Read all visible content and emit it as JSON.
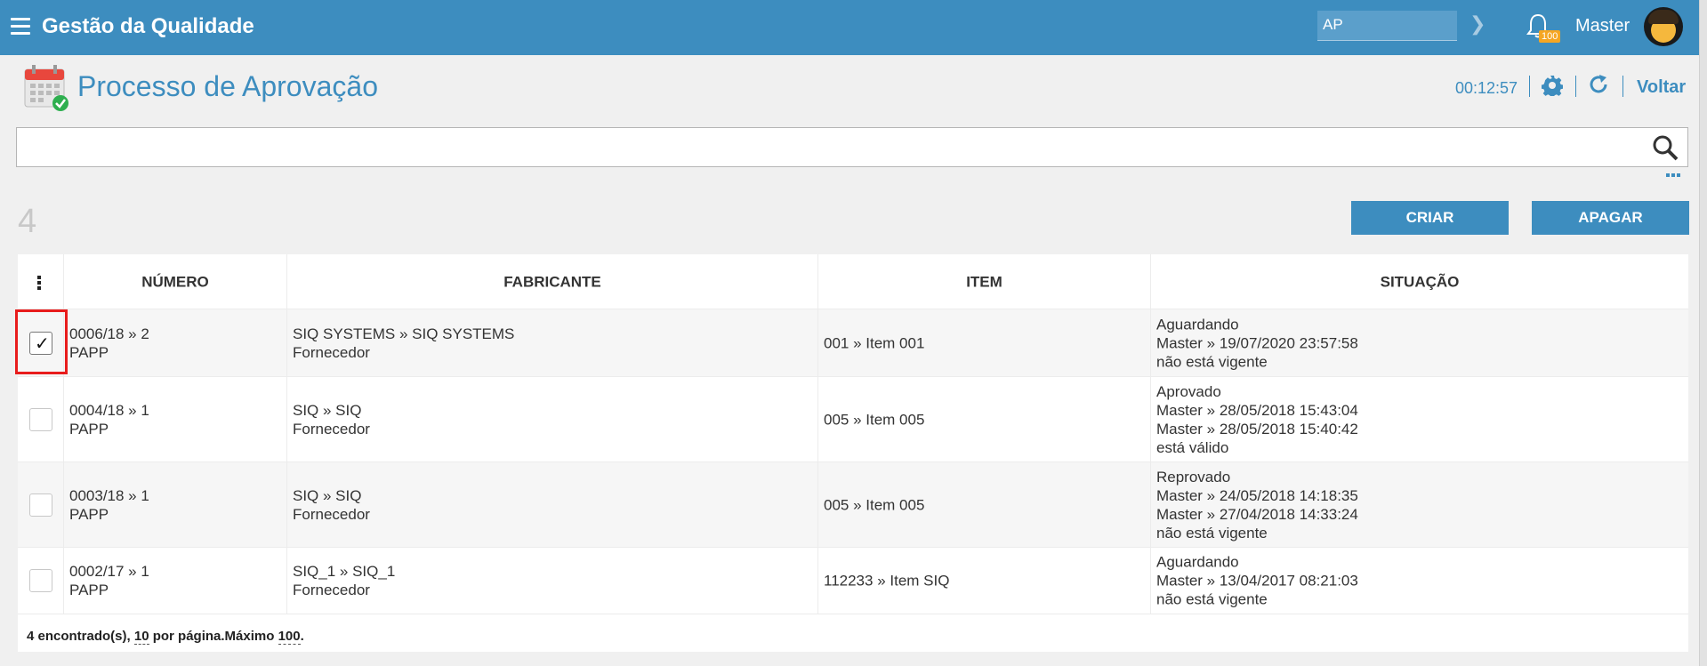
{
  "topbar": {
    "app_title": "Gestão da Qualidade",
    "search_value": "AP",
    "notification_count": "100",
    "username": "Master"
  },
  "header": {
    "page_title": "Processo de Aprovação",
    "timer": "00:12:57",
    "back_label": "Voltar"
  },
  "search": {
    "value": ""
  },
  "toolbar": {
    "record_count": "4",
    "create_label": "CRIAR",
    "delete_label": "APAGAR"
  },
  "table": {
    "headers": [
      "NÚMERO",
      "FABRICANTE",
      "ITEM",
      "SITUAÇÃO"
    ],
    "rows": [
      {
        "checked": true,
        "numero": [
          "0006/18 » 2",
          "PAPP"
        ],
        "fabricante": [
          "SIQ SYSTEMS » SIQ SYSTEMS",
          "Fornecedor"
        ],
        "item": [
          "001 » Item 001"
        ],
        "situacao": [
          "Aguardando",
          "Master » 19/07/2020 23:57:58",
          "não está vigente"
        ]
      },
      {
        "checked": false,
        "numero": [
          "0004/18 » 1",
          "PAPP"
        ],
        "fabricante": [
          "SIQ » SIQ",
          "Fornecedor"
        ],
        "item": [
          "005 » Item 005"
        ],
        "situacao": [
          "Aprovado",
          "Master » 28/05/2018 15:43:04",
          "Master » 28/05/2018 15:40:42",
          "está válido"
        ]
      },
      {
        "checked": false,
        "numero": [
          "0003/18 » 1",
          "PAPP"
        ],
        "fabricante": [
          "SIQ » SIQ",
          "Fornecedor"
        ],
        "item": [
          "005 » Item 005"
        ],
        "situacao": [
          "Reprovado",
          "Master » 24/05/2018 14:18:35",
          "Master » 27/04/2018 14:33:24",
          "não está vigente"
        ]
      },
      {
        "checked": false,
        "numero": [
          "0002/17 » 1",
          "PAPP"
        ],
        "fabricante": [
          "SIQ_1 » SIQ_1",
          "Fornecedor"
        ],
        "item": [
          "112233 » Item SIQ"
        ],
        "situacao": [
          "Aguardando",
          "Master » 13/04/2017 08:21:03",
          "não está vigente"
        ]
      }
    ]
  },
  "footer": {
    "found_text": "4 encontrado(s),",
    "per_page": "10",
    "per_page_text": "por página.Máximo",
    "max": "100",
    "end": "."
  },
  "colors": {
    "primary": "#3d8dbf",
    "badge": "#f5a623",
    "highlight": "#e81c1c"
  }
}
